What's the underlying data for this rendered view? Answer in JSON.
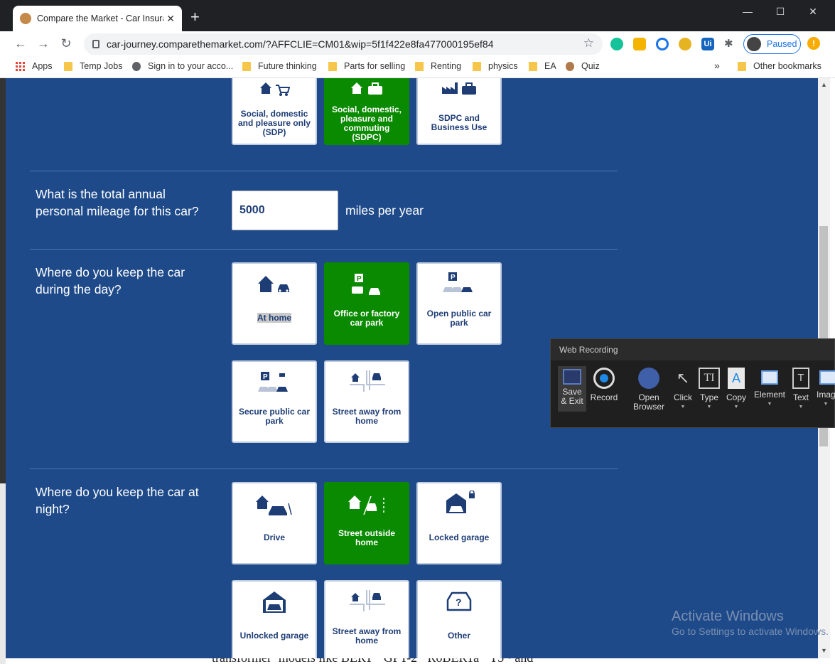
{
  "browser": {
    "tab_title": "Compare the Market - Car Insura",
    "url": "car-journey.comparethemarket.com/?AFFCLIE=CM01&wip=5f1f422e8fa477000195ef84",
    "profile_label": "Paused",
    "extension_ui_label": "Ui"
  },
  "bookmarks": [
    {
      "label": "Apps"
    },
    {
      "label": "Temp Jobs"
    },
    {
      "label": "Sign in to your acco..."
    },
    {
      "label": "Future thinking"
    },
    {
      "label": "Parts for selling"
    },
    {
      "label": "Renting"
    },
    {
      "label": "physics"
    },
    {
      "label": "EA"
    },
    {
      "label": "Quiz"
    },
    {
      "label": "»"
    },
    {
      "label": "Other bookmarks"
    }
  ],
  "usage": {
    "options": [
      {
        "label": "Social, domestic and pleasure only (SDP)"
      },
      {
        "label": "Social, domestic, pleasure and commuting (SDPC)"
      },
      {
        "label": "SDPC and Business Use"
      }
    ]
  },
  "mileage": {
    "question": "What is the total annual personal mileage for this car?",
    "value": "5000",
    "unit": "miles per year"
  },
  "day": {
    "question": "Where do you keep the car during the day?",
    "options": [
      {
        "label": "At home"
      },
      {
        "label": "Office or factory car park"
      },
      {
        "label": "Open public car park"
      },
      {
        "label": "Secure public car park"
      },
      {
        "label": "Street away from home"
      }
    ]
  },
  "night": {
    "question": "Where do you keep the car at night?",
    "options": [
      {
        "label": "Drive"
      },
      {
        "label": "Street outside home"
      },
      {
        "label": "Locked garage"
      },
      {
        "label": "Unlocked garage"
      },
      {
        "label": "Street away from home"
      },
      {
        "label": "Other"
      }
    ]
  },
  "recorder": {
    "title": "Web Recording",
    "tools": [
      {
        "label": "Save\n& Exit"
      },
      {
        "label": "Record"
      },
      {
        "label": "Open\nBrowser"
      },
      {
        "label": "Click"
      },
      {
        "label": "Type"
      },
      {
        "label": "Copy"
      },
      {
        "label": "Element"
      },
      {
        "label": "Text"
      },
      {
        "label": "Imag"
      }
    ]
  },
  "background": {
    "bottom_text": "transformer² models like BERT ⁹ GPT-2 ¹ RoBERTa ⁹ T5 ⁶ and"
  },
  "watermark": {
    "line1": "Activate Windows",
    "line2": "Go to Settings to activate Windows."
  },
  "colors": {
    "page_blue": "#1e4a8a",
    "selected_green": "#0a8a00",
    "label_navy": "#1e3d75"
  }
}
